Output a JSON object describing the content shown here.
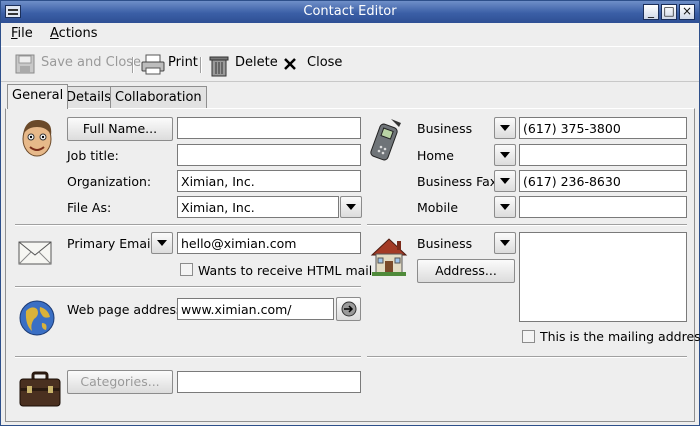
{
  "window": {
    "title": "Contact Editor"
  },
  "menubar": {
    "file": "F",
    "file_rest": "ile",
    "actions": "A",
    "actions_rest": "ctions"
  },
  "toolbar": {
    "save_close": "Save and Close",
    "print": "Print",
    "delete": "Delete",
    "close": "Close"
  },
  "tabs": [
    {
      "label": "General",
      "active": true
    },
    {
      "label": "Details"
    },
    {
      "label": "Collaboration"
    }
  ],
  "identity": {
    "full_name_button": "Full Name...",
    "full_name_value": "",
    "job_title_label": "Job title:",
    "job_title_value": "",
    "organization_label": "Organization:",
    "organization_value": "Ximian, Inc.",
    "file_as_label": "File As:",
    "file_as_value": "Ximian, Inc."
  },
  "phones": [
    {
      "label": "Business",
      "value": "(617) 375-3800"
    },
    {
      "label": "Home",
      "value": ""
    },
    {
      "label": "Business Fax",
      "value": "(617) 236-8630"
    },
    {
      "label": "Mobile",
      "value": ""
    }
  ],
  "email": {
    "label": "Primary Email",
    "value": "hello@ximian.com",
    "html_checkbox": "Wants to receive HTML mail",
    "html_checked": false
  },
  "address": {
    "type": "Business",
    "button": "Address...",
    "mailing_checkbox": "This is the mailing address",
    "mailing_checked": false,
    "value": ""
  },
  "web": {
    "label": "Web page address:",
    "value": "www.ximian.com/"
  },
  "categories": {
    "button": "Categories...",
    "value": ""
  }
}
